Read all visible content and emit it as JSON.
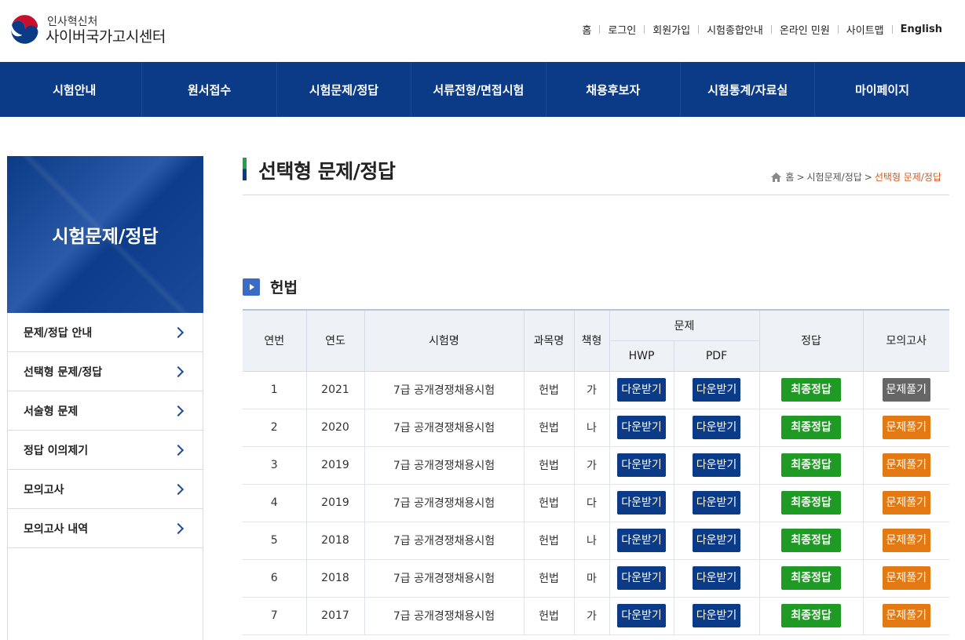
{
  "header": {
    "logo_small": "인사혁신처",
    "logo_big": "사이버국가고시센터",
    "top_links": [
      "홈",
      "로그인",
      "회원가입",
      "시험종합안내",
      "온라인 민원",
      "사이트맵",
      "English"
    ]
  },
  "gnb": [
    "시험안내",
    "원서접수",
    "시험문제/정답",
    "서류전형/면접시험",
    "채용후보자",
    "시험통계/자료실",
    "마이페이지"
  ],
  "sidebar": {
    "title": "시험문제/정답",
    "items": [
      "문제/정답 안내",
      "선택형 문제/정답",
      "서술형 문제",
      "정답 이의제기",
      "모의고사",
      "모의고사 내역"
    ]
  },
  "page": {
    "title": "선택형 문제/정답",
    "breadcrumb": [
      "홈",
      "시험문제/정답",
      "선택형 문제/정답"
    ]
  },
  "section": {
    "title": "헌법"
  },
  "table": {
    "headers": {
      "no": "연번",
      "year": "연도",
      "exam": "시험명",
      "subject": "과목명",
      "type": "책형",
      "problem": "문제",
      "hwp": "HWP",
      "pdf": "PDF",
      "answer": "정답",
      "mock": "모의고사"
    },
    "download_label": "다운받기",
    "answer_label": "최종정답",
    "mock_label": "문제풀기",
    "rows": [
      {
        "no": "1",
        "year": "2021",
        "exam": "7급 공개경쟁채용시험",
        "subject": "헌법",
        "type": "가",
        "mock_gray": true
      },
      {
        "no": "2",
        "year": "2020",
        "exam": "7급 공개경쟁채용시험",
        "subject": "헌법",
        "type": "나",
        "mock_gray": false
      },
      {
        "no": "3",
        "year": "2019",
        "exam": "7급 공개경쟁채용시험",
        "subject": "헌법",
        "type": "가",
        "mock_gray": false
      },
      {
        "no": "4",
        "year": "2019",
        "exam": "7급 공개경쟁채용시험",
        "subject": "헌법",
        "type": "다",
        "mock_gray": false
      },
      {
        "no": "5",
        "year": "2018",
        "exam": "7급 공개경쟁채용시험",
        "subject": "헌법",
        "type": "나",
        "mock_gray": false
      },
      {
        "no": "6",
        "year": "2018",
        "exam": "7급 공개경쟁채용시험",
        "subject": "헌법",
        "type": "마",
        "mock_gray": false
      },
      {
        "no": "7",
        "year": "2017",
        "exam": "7급 공개경쟁채용시험",
        "subject": "헌법",
        "type": "가",
        "mock_gray": false
      }
    ]
  },
  "colors": {
    "navy": "#0b3a86",
    "green": "#1f9a24",
    "orange": "#e27912",
    "gray": "#666666",
    "breadcrumb_current": "#d2581d"
  }
}
